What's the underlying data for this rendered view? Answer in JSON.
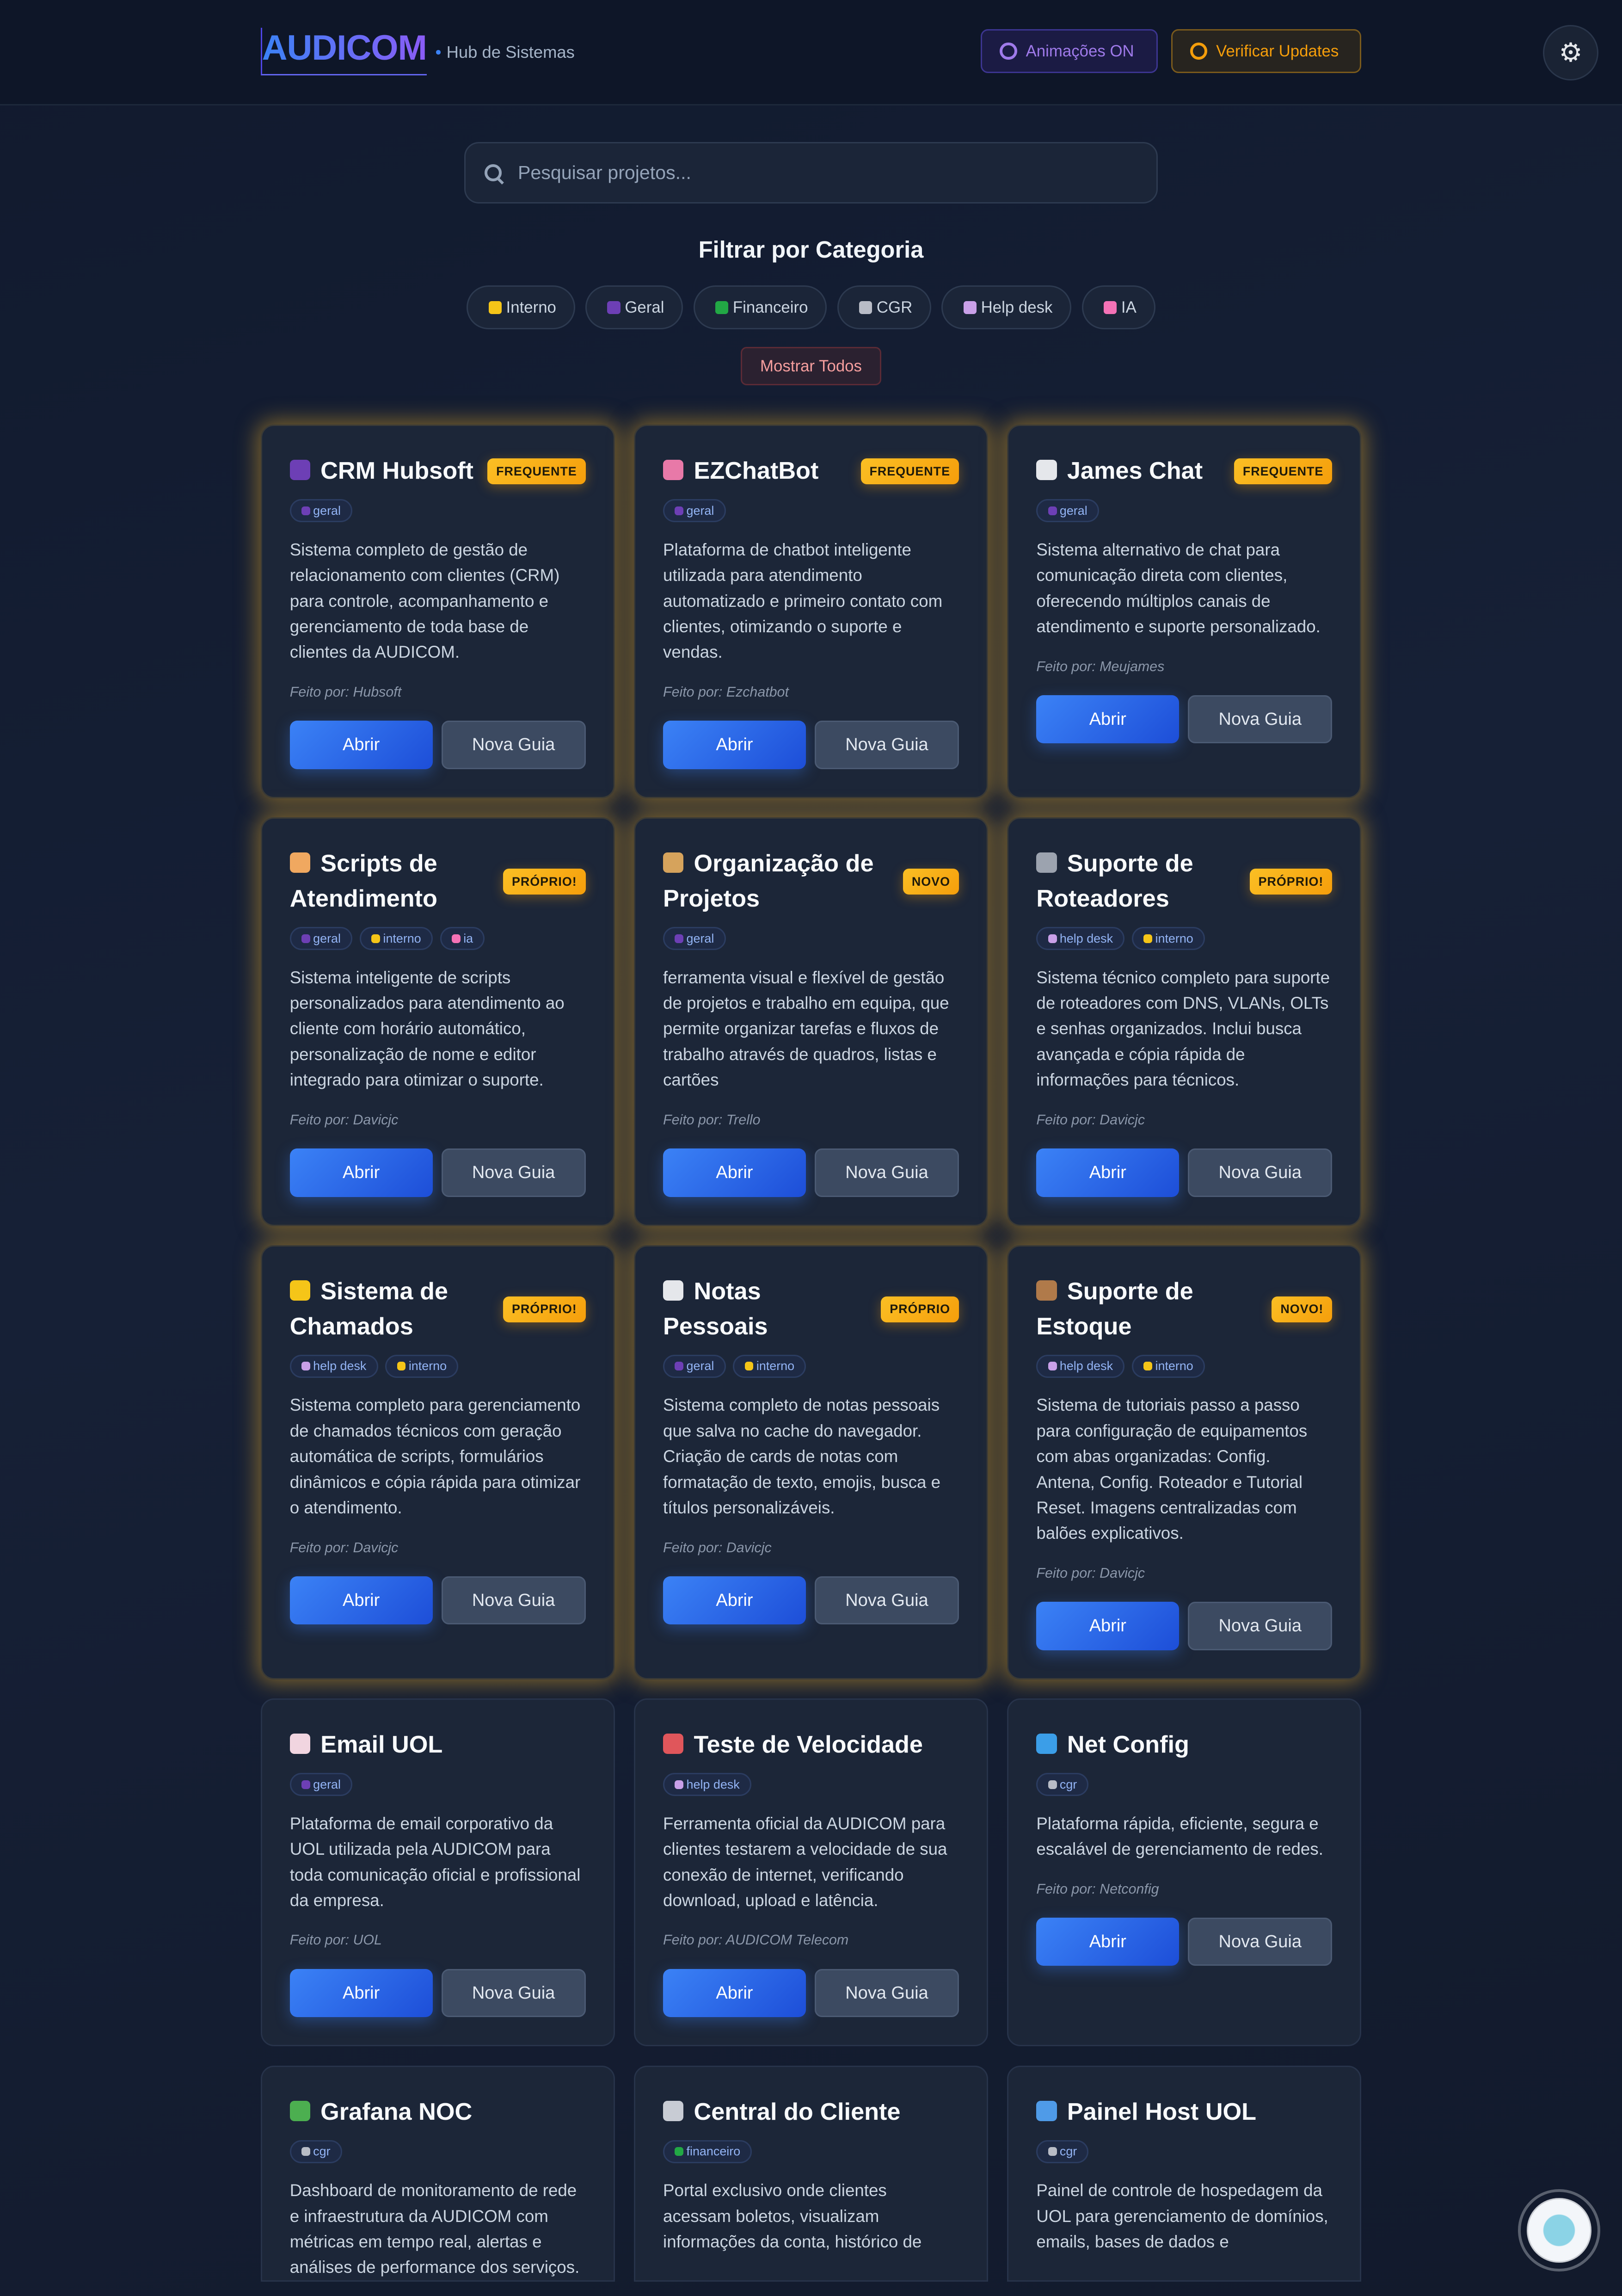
{
  "header": {
    "logo": "AUDICOM",
    "subtitle": "Hub de Sistemas",
    "animations_label": "Animações ON",
    "updates_label": "Verificar Updates",
    "settings_icon": "gear-icon"
  },
  "search": {
    "placeholder": "Pesquisar projetos...",
    "value": ""
  },
  "filters": {
    "title": "Filtrar por Categoria",
    "chips": [
      {
        "label": "Interno",
        "icon": "sun-icon",
        "color": "#f5c518"
      },
      {
        "label": "Geral",
        "icon": "people-icon",
        "color": "#6d3fb5"
      },
      {
        "label": "Financeiro",
        "icon": "money-icon",
        "color": "#22a845"
      },
      {
        "label": "CGR",
        "icon": "satellite-icon",
        "color": "#b8bcc6"
      },
      {
        "label": "Help desk",
        "icon": "technician-icon",
        "color": "#c9a0e8"
      },
      {
        "label": "IA",
        "icon": "brain-icon",
        "color": "#f472b6"
      }
    ],
    "show_all": "Mostrar Todos"
  },
  "tag_colors": {
    "geral": "#6d3fb5",
    "interno": "#f5c518",
    "ia": "#f472b6",
    "help desk": "#c9a0e8",
    "cgr": "#b8bcc6",
    "financeiro": "#22a845"
  },
  "card_buttons": {
    "open": "Abrir",
    "new_tab": "Nova Guia"
  },
  "colors": {
    "accent": "#3b82f6",
    "badge": "#fbbf24",
    "highlight_glow": "#c8962a"
  },
  "cards": [
    {
      "title": "CRM Hubsoft",
      "icon": "people-icon",
      "icon_color": "#6d3fb5",
      "badge": "FREQUENTE",
      "highlighted": true,
      "tags": [
        "geral"
      ],
      "description": "Sistema completo de gestão de relacionamento com clientes (CRM) para controle, acompanhamento e gerenciamento de toda base de clientes da AUDICOM.",
      "made_by": "Feito por: Hubsoft"
    },
    {
      "title": "EZChatBot",
      "icon": "robot-icon",
      "icon_color": "#e879a8",
      "badge": "FREQUENTE",
      "highlighted": true,
      "tags": [
        "geral"
      ],
      "description": "Plataforma de chatbot inteligente utilizada para atendimento automatizado e primeiro contato com clientes, otimizando o suporte e vendas.",
      "made_by": "Feito por: Ezchatbot"
    },
    {
      "title": "James Chat",
      "icon": "speech-bubble-icon",
      "icon_color": "#e5e7eb",
      "badge": "FREQUENTE",
      "highlighted": true,
      "tags": [
        "geral"
      ],
      "description": "Sistema alternativo de chat para comunicação direta com clientes, oferecendo múltiplos canais de atendimento e suporte personalizado.",
      "made_by": "Feito por: Meujames"
    },
    {
      "title": "Scripts de Atendimento",
      "icon": "memo-icon",
      "icon_color": "#f0a860",
      "badge": "PRÓPRIO!",
      "highlighted": true,
      "tags": [
        "geral",
        "interno",
        "ia"
      ],
      "description": "Sistema inteligente de scripts personalizados para atendimento ao cliente com horário automático, personalização de nome e editor integrado para otimizar o suporte.",
      "made_by": "Feito por: Davicjc"
    },
    {
      "title": "Organização de Projetos",
      "icon": "clipboard-icon",
      "icon_color": "#d6a35c",
      "badge": "NOVO",
      "highlighted": true,
      "tags": [
        "geral"
      ],
      "description": "ferramenta visual e flexível de gestão de projetos e trabalho em equipa, que permite organizar tarefas e fluxos de trabalho através de quadros, listas e cartões",
      "made_by": "Feito por: Trello"
    },
    {
      "title": "Suporte de Roteadores",
      "icon": "wrench-icon",
      "icon_color": "#9ca3af",
      "badge": "PRÓPRIO!",
      "highlighted": true,
      "tags": [
        "help desk",
        "interno"
      ],
      "description": "Sistema técnico completo para suporte de roteadores com DNS, VLANs, OLTs e senhas organizados. Inclui busca avançada e cópia rápida de informações para técnicos.",
      "made_by": "Feito por: Davicjc"
    },
    {
      "title": "Sistema de Chamados",
      "icon": "ticket-icon",
      "icon_color": "#f5c518",
      "badge": "PRÓPRIO!",
      "highlighted": true,
      "tags": [
        "help desk",
        "interno"
      ],
      "description": "Sistema completo para gerenciamento de chamados técnicos com geração automática de scripts, formulários dinâmicos e cópia rápida para otimizar o atendimento.",
      "made_by": "Feito por: Davicjc"
    },
    {
      "title": "Notas Pessoais",
      "icon": "notepad-icon",
      "icon_color": "#e5e7eb",
      "badge": "PRÓPRIO",
      "highlighted": true,
      "tags": [
        "geral",
        "interno"
      ],
      "description": "Sistema completo de notas pessoais que salva no cache do navegador. Criação de cards de notas com formatação de texto, emojis, busca e títulos personalizáveis.",
      "made_by": "Feito por: Davicjc"
    },
    {
      "title": "Suporte de Estoque",
      "icon": "package-icon",
      "icon_color": "#b07a4a",
      "badge": "NOVO!",
      "highlighted": true,
      "tags": [
        "help desk",
        "interno"
      ],
      "description": "Sistema de tutoriais passo a passo para configuração de equipamentos com abas organizadas: Config. Antena, Config. Roteador e Tutorial Reset. Imagens centralizadas com balões explicativos.",
      "made_by": "Feito por: Davicjc"
    },
    {
      "title": "Email UOL",
      "icon": "envelope-icon",
      "icon_color": "#f1d5e0",
      "badge": "",
      "highlighted": false,
      "tags": [
        "geral"
      ],
      "description": "Plataforma de email corporativo da UOL utilizada pela AUDICOM para toda comunicação oficial e profissional da empresa.",
      "made_by": "Feito por: UOL"
    },
    {
      "title": "Teste de Velocidade",
      "icon": "rocket-icon",
      "icon_color": "#e0565b",
      "badge": "",
      "highlighted": false,
      "tags": [
        "help desk"
      ],
      "description": "Ferramenta oficial da AUDICOM para clientes testarem a velocidade de sua conexão de internet, verificando download, upload e latência.",
      "made_by": "Feito por: AUDICOM Telecom"
    },
    {
      "title": "Net Config",
      "icon": "globe-icon",
      "icon_color": "#3b9ee8",
      "badge": "",
      "highlighted": false,
      "tags": [
        "cgr"
      ],
      "description": "Plataforma rápida, eficiente, segura e escalável de gerenciamento de redes.",
      "made_by": "Feito por: Netconfig"
    },
    {
      "title": "Grafana NOC",
      "icon": "bar-chart-icon",
      "icon_color": "#4caf50",
      "badge": "",
      "highlighted": false,
      "tags": [
        "cgr"
      ],
      "description": "Dashboard de monitoramento de rede e infraestrutura da AUDICOM com métricas em tempo real, alertas e análises de performance dos serviços.",
      "made_by": ""
    },
    {
      "title": "Central do Cliente",
      "icon": "bank-icon",
      "icon_color": "#c8ccd4",
      "badge": "",
      "highlighted": false,
      "tags": [
        "financeiro"
      ],
      "description": "Portal exclusivo onde clientes acessam boletos, visualizam informações da conta, histórico de",
      "made_by": ""
    },
    {
      "title": "Painel Host UOL",
      "icon": "computer-icon",
      "icon_color": "#4f9be8",
      "badge": "",
      "highlighted": false,
      "tags": [
        "cgr"
      ],
      "description": "Painel de controle de hospedagem da UOL para gerenciamento de domínios, emails, bases de dados e",
      "made_by": ""
    }
  ],
  "assistant": {
    "icon": "support-bot-icon"
  }
}
